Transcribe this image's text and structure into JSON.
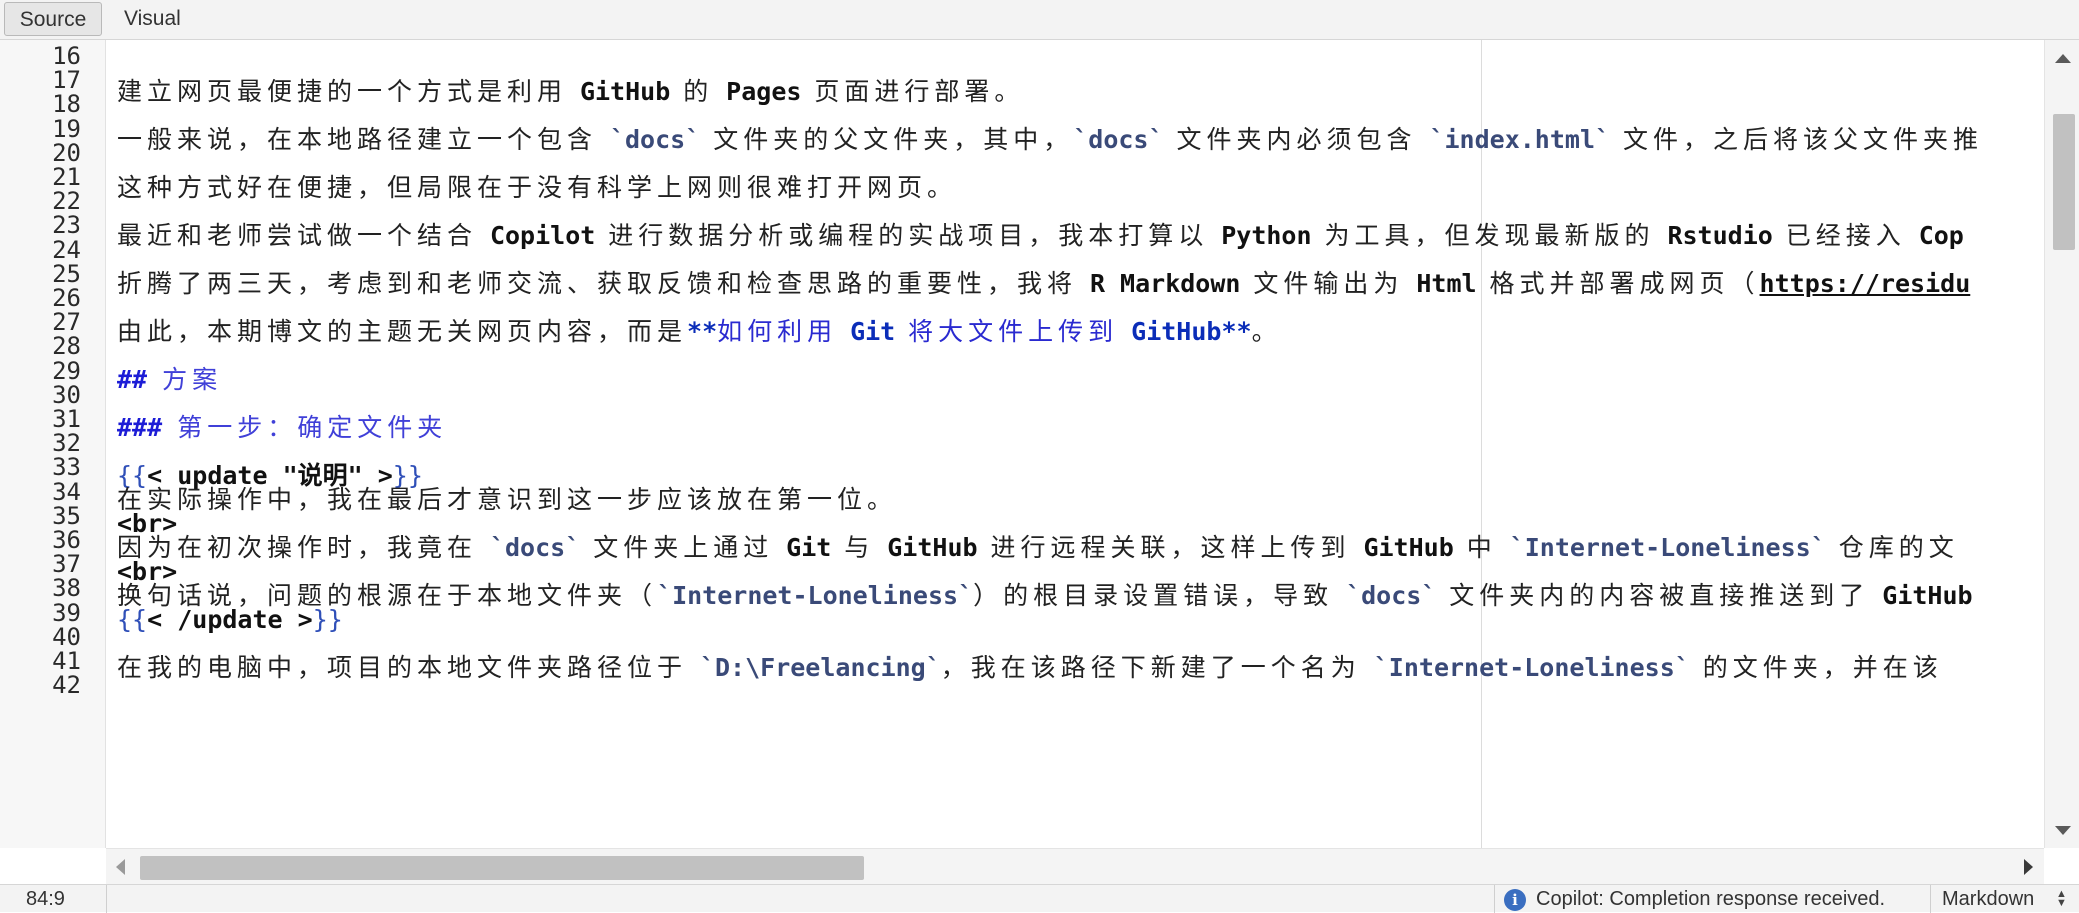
{
  "toolbar": {
    "source_label": "Source",
    "visual_label": "Visual"
  },
  "editor": {
    "line_numbers": [
      "16",
      "17",
      "18",
      "19",
      "20",
      "21",
      "22",
      "23",
      "24",
      "25",
      "26",
      "27",
      "28",
      "29",
      "30",
      "31",
      "32",
      "33",
      "34",
      "35",
      "36",
      "37",
      "38",
      "39",
      "40",
      "41",
      "42"
    ],
    "lines": {
      "l17": {
        "a": "建立网页最便捷的一个方式是利用 ",
        "b": "GitHub",
        "c": " 的 ",
        "d": "Pages",
        "e": " 页面进行部署。"
      },
      "l19": {
        "a": "一般来说，在本地路径建立一个包含 ",
        "b": "`docs`",
        "c": " 文件夹的父文件夹，其中，",
        "d": "`docs`",
        "e": " 文件夹内必须包含 ",
        "f": "`index.html`",
        "g": " 文件，之后将该父文件夹推"
      },
      "l21": {
        "a": "这种方式好在便捷，但局限在于没有科学上网则很难打开网页。"
      },
      "l23": {
        "a": "最近和老师尝试做一个结合 ",
        "b": "Copilot",
        "c": " 进行数据分析或编程的实战项目，我本打算以 ",
        "d": "Python",
        "e": " 为工具，但发现最新版的 ",
        "f": "Rstudio",
        "g": " 已经接入 ",
        "h": "Cop"
      },
      "l25": {
        "a": "折腾了两三天，考虑到和老师交流、获取反馈和检查思路的重要性，我将 ",
        "b": "R Markdown",
        "c": " 文件输出为 ",
        "d": "Html",
        "e": " 格式并部署成网页（",
        "f": "https://residu"
      },
      "l27": {
        "a": "由此，本期博文的主题无关网页内容，而是",
        "b": "**",
        "c": "如何利用 ",
        "d": "Git",
        "e": " 将大文件上传到 ",
        "f": "GitHub**",
        "g": "。"
      },
      "l29": {
        "a": "## ",
        "b": "方案"
      },
      "l31": {
        "a": "### ",
        "b": "第一步：确定文件夹"
      },
      "l33": {
        "a": "{{",
        "b": "< update \"说明\" >",
        "c": "}}"
      },
      "l34": {
        "a": "在实际操作中，我在最后才意识到这一步应该放在第一位。"
      },
      "l35": {
        "a": "<br>"
      },
      "l36": {
        "a": "因为在初次操作时，我竟在 ",
        "b": "`docs`",
        "c": " 文件夹上通过 ",
        "d": "Git",
        "e": " 与 ",
        "f": "GitHub",
        "g": " 进行远程关联，这样上传到 ",
        "h": "GitHub",
        "i": " 中 ",
        "j": "`Internet-Loneliness`",
        "k": " 仓库的文"
      },
      "l37": {
        "a": "<br>"
      },
      "l38": {
        "a": "换句话说，问题的根源在于本地文件夹（",
        "b": "`Internet-Loneliness`",
        "c": "）的根目录设置错误，导致 ",
        "d": "`docs`",
        "e": " 文件夹内的内容被直接推送到了 ",
        "f": "GitHub"
      },
      "l39": {
        "a": "{{",
        "b": "< /update >",
        "c": "}}"
      },
      "l41": {
        "a": "在我的电脑中，项目的本地文件夹路径位于 ",
        "b": "`D:\\Freelancing`",
        "c": "，我在该路径下新建了一个名为 ",
        "d": "`Internet-Loneliness`",
        "e": " 的文件夹，并在该"
      }
    }
  },
  "status": {
    "position": "84:9",
    "message": "Copilot: Completion response received.",
    "language": "Markdown"
  },
  "colors": {
    "heading": "#1c1cd6",
    "code": "#3a4a78",
    "strong": "#0b2db8",
    "info": "#3a6ec0"
  }
}
